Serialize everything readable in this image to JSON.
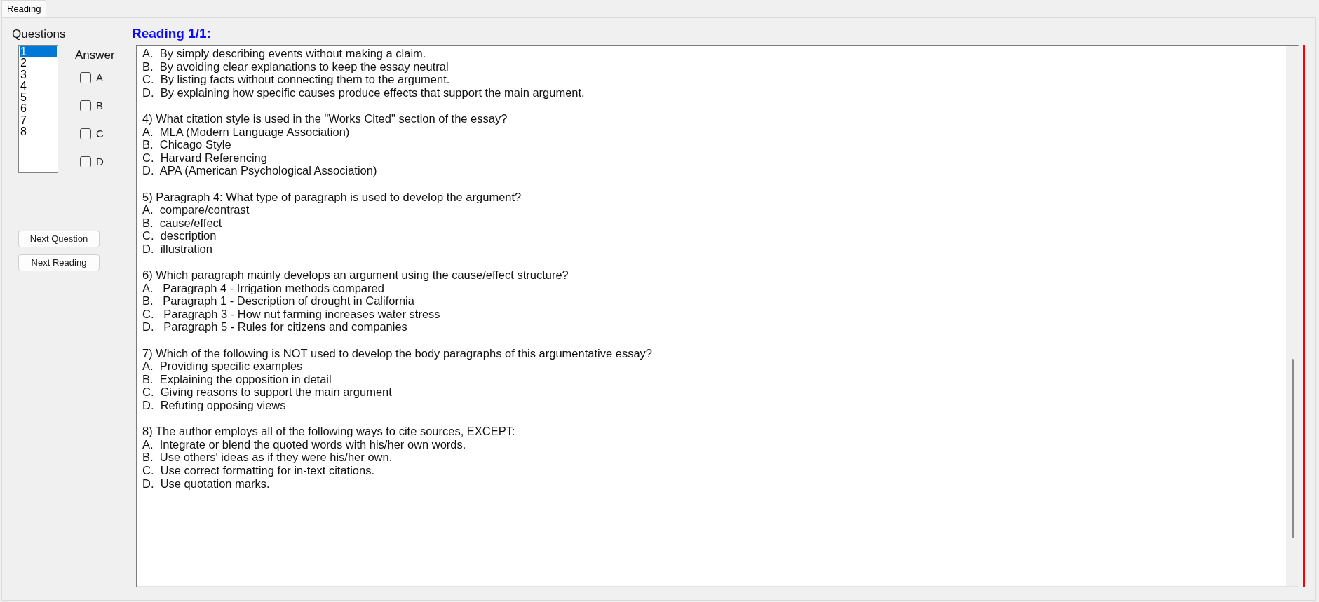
{
  "tabs": [
    {
      "label": "Reading",
      "selected": true
    }
  ],
  "questions_panel": {
    "title": "Questions",
    "items": [
      {
        "label": "1",
        "selected": true
      },
      {
        "label": "2",
        "selected": false
      },
      {
        "label": "3",
        "selected": false
      },
      {
        "label": "4",
        "selected": false
      },
      {
        "label": "5",
        "selected": false
      },
      {
        "label": "6",
        "selected": false
      },
      {
        "label": "7",
        "selected": false
      },
      {
        "label": "8",
        "selected": false
      }
    ]
  },
  "answer_panel": {
    "title": "Answer",
    "options": [
      {
        "label": "A",
        "checked": false
      },
      {
        "label": "B",
        "checked": false
      },
      {
        "label": "C",
        "checked": false
      },
      {
        "label": "D",
        "checked": false
      }
    ]
  },
  "buttons": [
    {
      "label": "Next Question"
    },
    {
      "label": "Next Reading"
    }
  ],
  "reading": {
    "title": "Reading 1/1:",
    "blocks": [
      {
        "options": [
          "A.  By simply describing events without making a claim.",
          "B.  By avoiding clear explanations to keep the essay neutral",
          "C.  By listing facts without connecting them to the argument.",
          "D.  By explaining how specific causes produce effects that support the main argument."
        ]
      },
      {
        "prompt": "4) What citation style is used in the \"Works Cited\" section of the essay?",
        "options": [
          "A.  MLA (Modern Language Association)",
          "B.  Chicago Style",
          "C.  Harvard Referencing",
          "D.  APA (American Psychological Association)"
        ]
      },
      {
        "prompt": "5) Paragraph 4: What type of paragraph is used to develop the argument?",
        "options": [
          "A.  compare/contrast",
          "B.  cause/effect",
          "C.  description",
          "D.  illustration"
        ]
      },
      {
        "prompt": "6) Which paragraph mainly develops an argument using the cause/effect structure?",
        "options": [
          "A.   Paragraph 4 - Irrigation methods compared",
          "B.   Paragraph 1 - Description of drought in California",
          "C.   Paragraph 3 - How nut farming increases water stress",
          "D.   Paragraph 5 - Rules for citizens and companies"
        ]
      },
      {
        "prompt": "7) Which of the following is NOT used to develop the body paragraphs of this argumentative essay?",
        "options": [
          "A.  Providing specific examples",
          "B.  Explaining the opposition in detail",
          "C.  Giving reasons to support the main argument",
          "D.  Refuting opposing views"
        ]
      },
      {
        "prompt": "8) The author employs all of the following ways to cite sources, EXCEPT:",
        "options": [
          "A.  Integrate or blend the quoted words with his/her own words.",
          "B.  Use others' ideas as if they were his/her own.",
          "C.  Use correct formatting for in-text citations.",
          "D.  Use quotation marks."
        ]
      }
    ]
  }
}
